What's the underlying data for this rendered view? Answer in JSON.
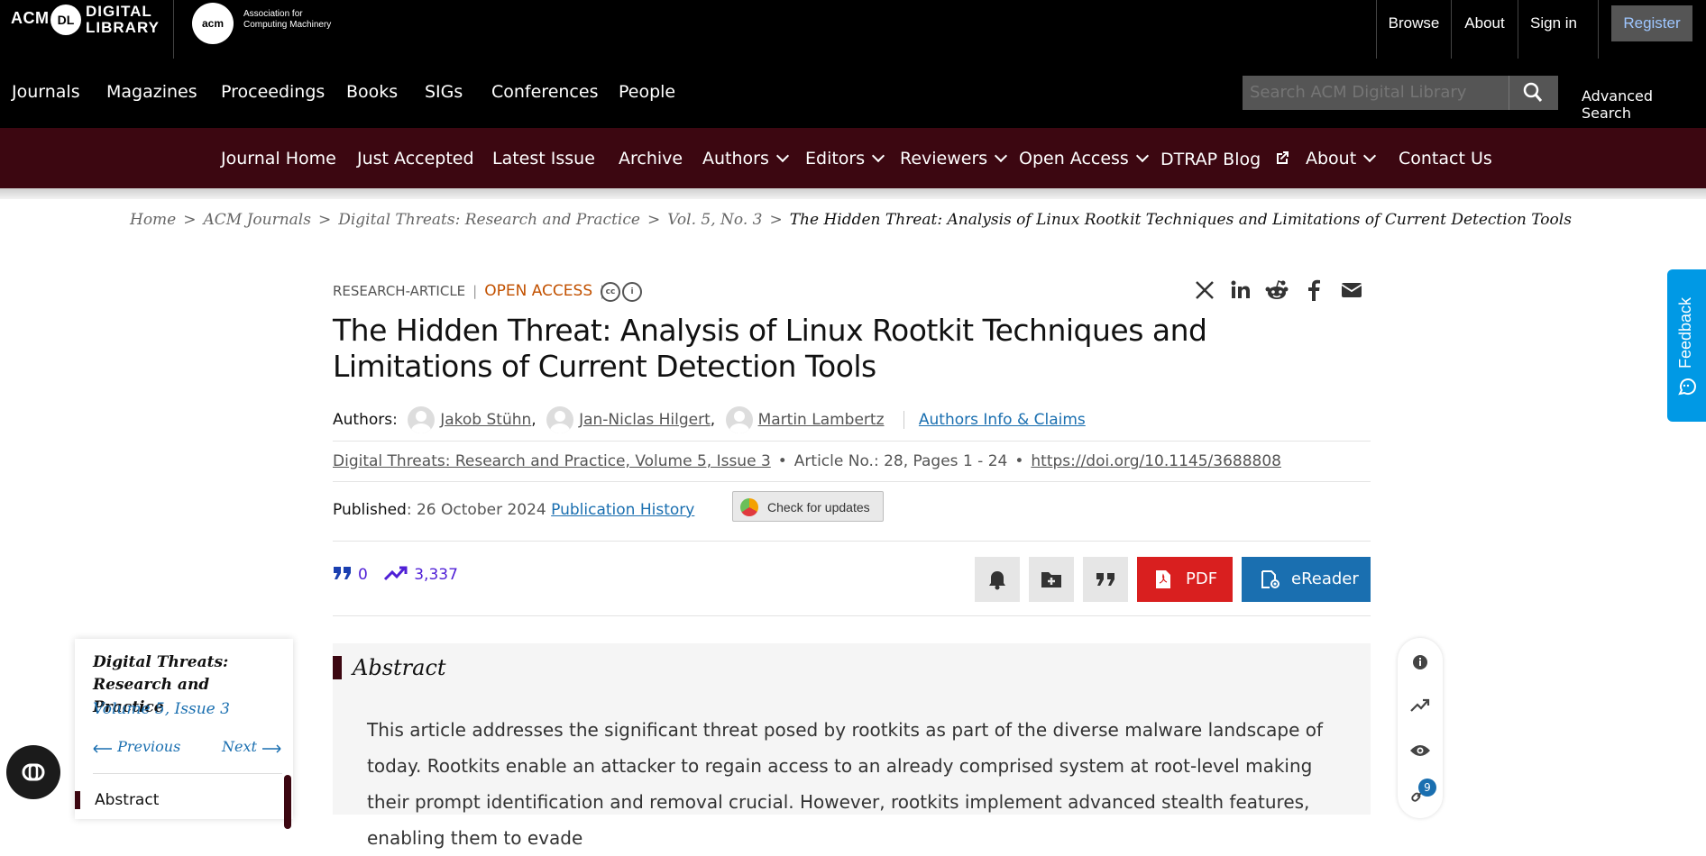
{
  "header": {
    "acm": "ACM",
    "dl": "DL",
    "digital_library": [
      "DIGITAL",
      "LIBRARY"
    ],
    "acm_logo": "acm",
    "association": [
      "Association for",
      "Computing Machinery"
    ],
    "nav": [
      "Browse",
      "About",
      "Sign in"
    ],
    "register": "Register"
  },
  "mainnav": {
    "items": [
      "Journals",
      "Magazines",
      "Proceedings",
      "Books",
      "SIGs",
      "Conferences",
      "People"
    ],
    "search_placeholder": "Search ACM Digital Library",
    "advanced_search": "Advanced Search"
  },
  "journalnav": {
    "items": [
      "Journal Home",
      "Just Accepted",
      "Latest Issue",
      "Archive",
      "Authors",
      "Editors",
      "Reviewers",
      "Open Access",
      "DTRAP Blog",
      "About",
      "Contact Us"
    ]
  },
  "breadcrumb": [
    "Home",
    "ACM Journals",
    "Digital Threats: Research and Practice",
    "Vol. 5, No. 3",
    "The Hidden Threat: Analysis of Linux Rootkit Techniques and Limitations of Current Detection Tools"
  ],
  "article": {
    "type": "RESEARCH-ARTICLE",
    "access": "OPEN ACCESS",
    "title": "The Hidden Threat: Analysis of Linux Rootkit Techniques and Limitations of Current Detection Tools",
    "authors_label": "Authors",
    "authors": [
      "Jakob Stühn",
      "Jan-Niclas Hilgert",
      "Martin Lambertz"
    ],
    "authors_info": "Authors Info & Claims",
    "journal_link": "Digital Threats: Research and Practice, Volume 5, Issue 3",
    "article_no": "Article No.: 28, Pages 1 - 24",
    "doi": "https://doi.org/10.1145/3688808",
    "published_label": "Published",
    "published_date": ": 26 October 2024",
    "publication_history": "Publication History",
    "check_updates": "Check for updates",
    "citations": "0",
    "downloads": "3,337",
    "pdf": "PDF",
    "ereader": "eReader"
  },
  "journal_card": {
    "title": "Digital Threats: Research and Practice",
    "volume": "Volume 5, Issue 3",
    "previous": "Previous",
    "next": "Next",
    "toc_abstract": "Abstract"
  },
  "abstract": {
    "heading": "Abstract",
    "text": "This article addresses the significant threat posed by rootkits as part of the diverse malware landscape of today. Rootkits enable an attacker to regain access to an already comprised system at root-level making their prompt identification and removal crucial. However, rootkits implement advanced stealth features, enabling them to evade"
  },
  "side_rail": {
    "badge": "9"
  },
  "feedback": "Feedback",
  "colors": {
    "journal_nav": "#3c0711",
    "open_access": "#c25100",
    "link": "#1a6fb0",
    "pdf": "#d91f1f",
    "metrics": "#4f1fd6",
    "feedback": "#0099e5"
  }
}
